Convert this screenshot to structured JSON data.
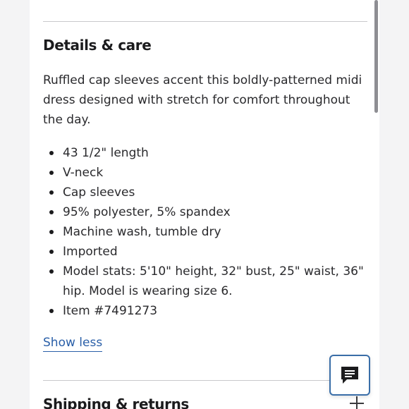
{
  "section": {
    "title": "Details & care",
    "description": "Ruffled cap sleeves accent this boldly-patterned midi dress designed with stretch for comfort throughout the day.",
    "bullets": [
      "43 1/2\" length",
      "V-neck",
      "Cap sleeves",
      "95% polyester, 5% spandex",
      "Machine wash, tumble dry",
      "Imported",
      "Model stats: 5'10\" height, 32\" bust, 25\" waist, 36\" hip. Model is wearing size 6.",
      "Item #7491273"
    ],
    "toggle_label": "Show less"
  },
  "next_section": {
    "title": "Shipping & returns",
    "expand_icon": "plus-icon"
  },
  "chat": {
    "icon": "chat-bubble-icon"
  },
  "colors": {
    "link": "#2a5fa8",
    "chat_border": "#3a6ea8",
    "text": "#2a2a2d",
    "heading": "#1b1b1d"
  }
}
